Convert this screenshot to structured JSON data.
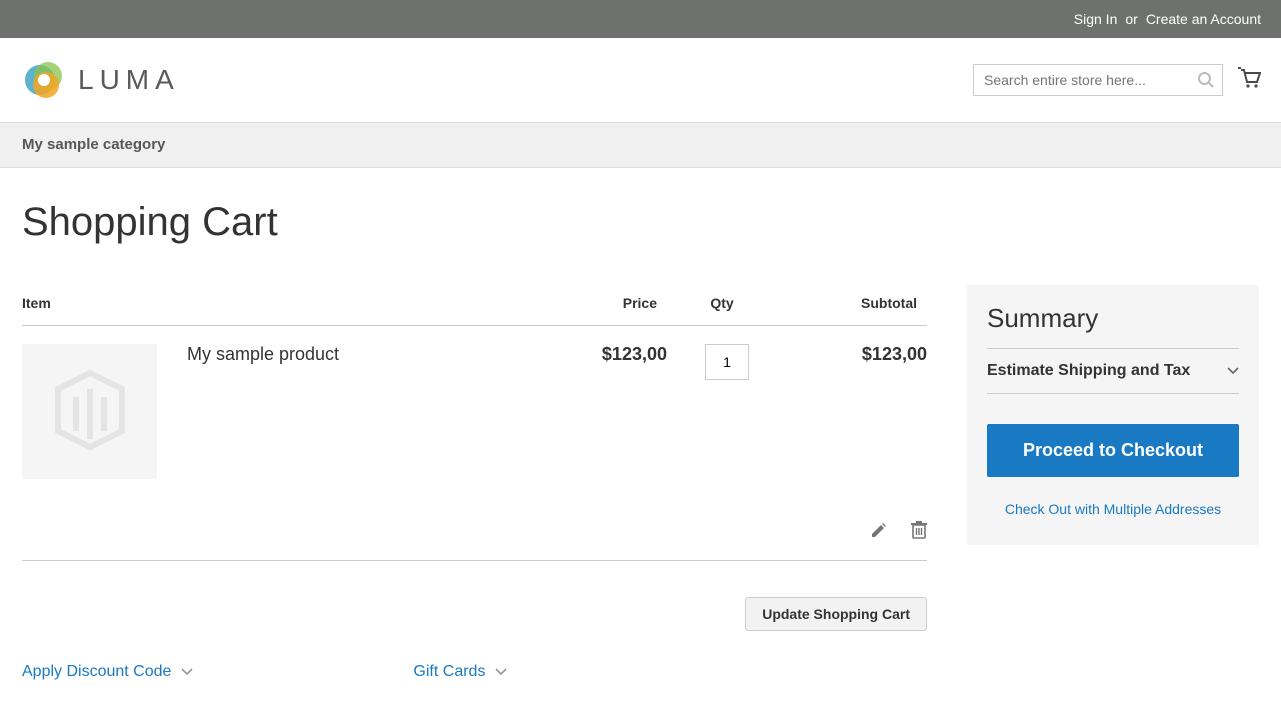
{
  "topbar": {
    "signin": "Sign In",
    "or": "or",
    "create": "Create an Account"
  },
  "header": {
    "logo_text": "LUMA",
    "search_placeholder": "Search entire store here..."
  },
  "nav": {
    "category": "My sample category"
  },
  "page": {
    "title": "Shopping Cart"
  },
  "cart": {
    "headers": {
      "item": "Item",
      "price": "Price",
      "qty": "Qty",
      "subtotal": "Subtotal"
    },
    "items": [
      {
        "name": "My sample product",
        "price": "$123,00",
        "qty": "1",
        "subtotal": "$123,00"
      }
    ],
    "update_label": "Update Shopping Cart"
  },
  "links": {
    "discount": "Apply Discount Code",
    "giftcards": "Gift Cards"
  },
  "summary": {
    "title": "Summary",
    "estimate": "Estimate Shipping and Tax",
    "checkout": "Proceed to Checkout",
    "multi": "Check Out with Multiple Addresses"
  }
}
